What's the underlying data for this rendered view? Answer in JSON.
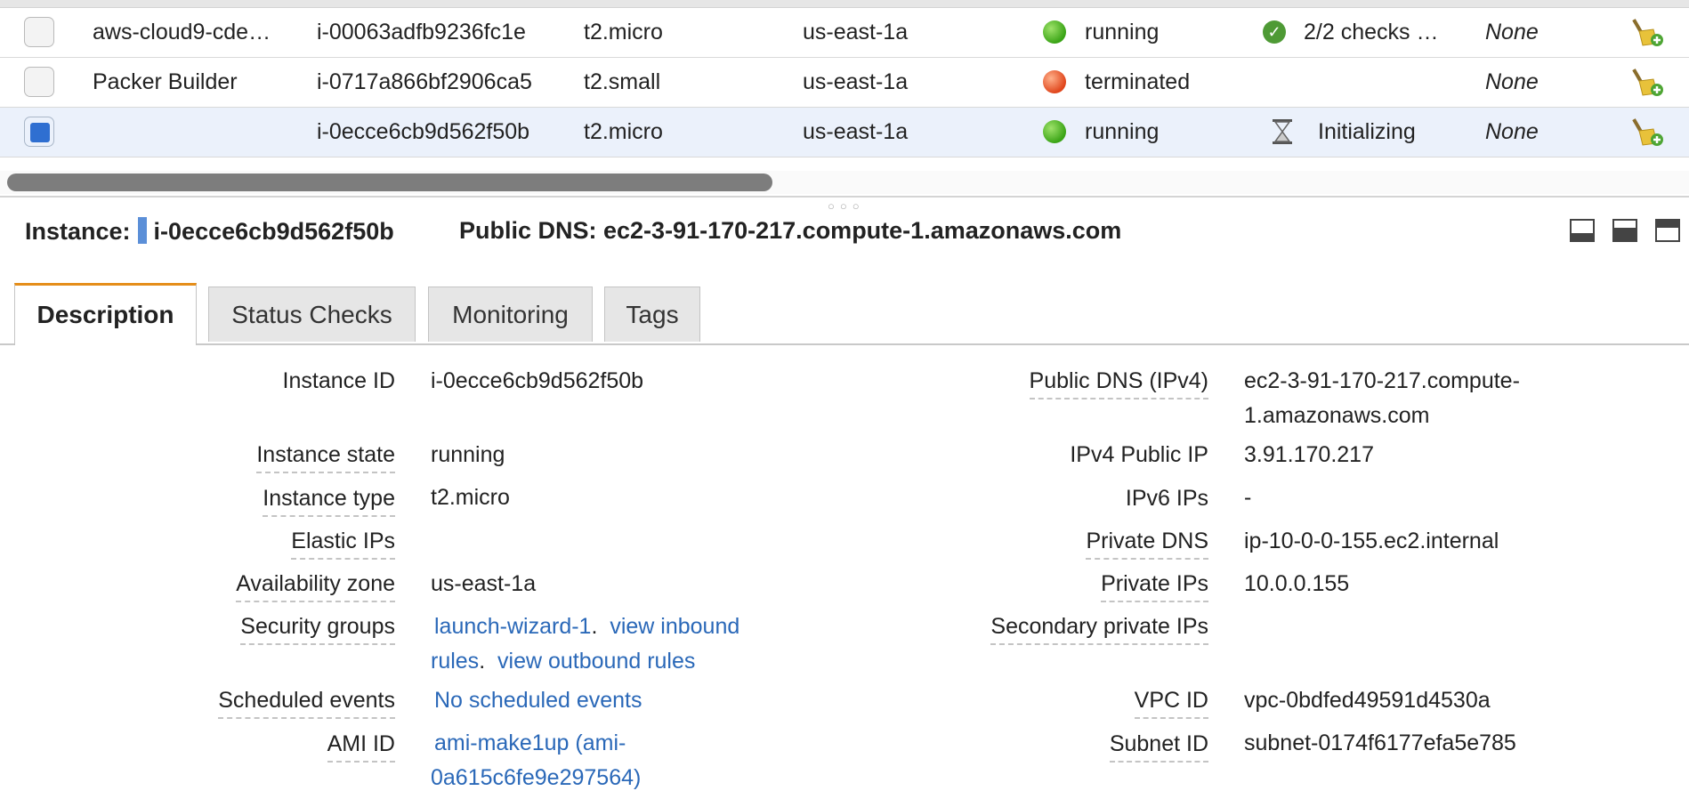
{
  "table": {
    "rows": [
      {
        "name": "aws-cloud9-cde…",
        "instance_id": "i-00063adfb9236fc1e",
        "type": "t2.micro",
        "az": "us-east-1a",
        "state": "running",
        "status": "2/2 checks …",
        "alarm": "None"
      },
      {
        "name": "Packer Builder",
        "instance_id": "i-0717a866bf2906ca5",
        "type": "t2.small",
        "az": "us-east-1a",
        "state": "terminated",
        "status": "",
        "alarm": "None"
      },
      {
        "name": "",
        "instance_id": "i-0ecce6cb9d562f50b",
        "type": "t2.micro",
        "az": "us-east-1a",
        "state": "running",
        "status": "Initializing",
        "alarm": "None"
      }
    ]
  },
  "detail": {
    "instance_label": "Instance:",
    "instance_id": "i-0ecce6cb9d562f50b",
    "dns_label": "Public DNS: ec2-3-91-170-217.compute-1.amazonaws.com"
  },
  "tabs": [
    "Description",
    "Status Checks",
    "Monitoring",
    "Tags"
  ],
  "description": {
    "left": [
      {
        "label": "Instance ID",
        "value": "i-0ecce6cb9d562f50b"
      },
      {
        "label": "Instance state",
        "value": "running"
      },
      {
        "label": "Instance type",
        "value": "t2.micro"
      },
      {
        "label": "Elastic IPs",
        "value": ""
      },
      {
        "label": "Availability zone",
        "value": "us-east-1a"
      },
      {
        "label": "Security groups",
        "value_link1": "launch-wizard-1",
        "value_link2": "view inbound",
        "value_link3": "rules",
        "value_link4": "view outbound rules"
      },
      {
        "label": "Scheduled events",
        "value": "No scheduled events"
      },
      {
        "label": "AMI ID",
        "value_line1": "ami-make1up (ami-",
        "value_line2": "0a615c6fe9e297564)"
      }
    ],
    "right": [
      {
        "label": "Public DNS (IPv4)",
        "value_line1": "ec2-3-91-170-217.compute-",
        "value_line2": "1.amazonaws.com"
      },
      {
        "label": "IPv4 Public IP",
        "value": "3.91.170.217"
      },
      {
        "label": "IPv6 IPs",
        "value": "-"
      },
      {
        "label": "Private DNS",
        "value": "ip-10-0-0-155.ec2.internal"
      },
      {
        "label": "Private IPs",
        "value": "10.0.0.155"
      },
      {
        "label": "Secondary private IPs",
        "value": ""
      },
      {
        "label": "VPC ID",
        "value": "vpc-0bdfed49591d4530a"
      },
      {
        "label": "Subnet ID",
        "value": "subnet-0174f6177efa5e785"
      }
    ]
  },
  "colors": {
    "accent_tab": "#e58e1a",
    "link": "#2a68b8",
    "selected_row": "#ebf1fb",
    "running": "#3aa416",
    "terminated": "#e0461c"
  },
  "icons": [
    "checkbox",
    "status-dot",
    "check-circle-icon",
    "hourglass-icon",
    "broom-icon",
    "layout-bottom-icon",
    "layout-middle-icon",
    "layout-top-icon"
  ]
}
